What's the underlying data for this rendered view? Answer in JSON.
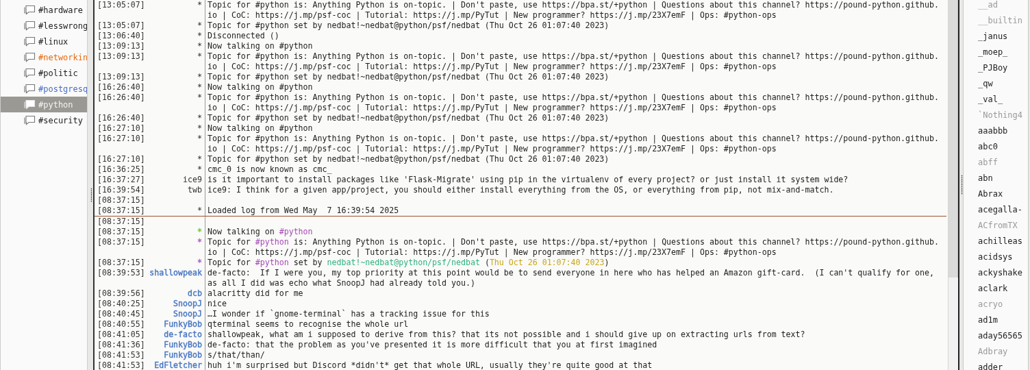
{
  "channels": [
    {
      "name": "#hardware",
      "selected": false
    },
    {
      "name": "#lesswrong",
      "selected": false
    },
    {
      "name": "#linux",
      "selected": false
    },
    {
      "name": "#networkin",
      "selected": false,
      "color": "#e66a0e"
    },
    {
      "name": "#politic",
      "selected": false
    },
    {
      "name": "#postgresq",
      "selected": false,
      "color": "#4a6fc4"
    },
    {
      "name": "#python",
      "selected": true
    },
    {
      "name": "#security",
      "selected": false
    }
  ],
  "log": {
    "history": [
      {
        "time": "[13:05:07]",
        "nick": "*",
        "text": "Topic for #python is: Anything Python is on-topic. | Don't paste, use https://bpa.st/+python | Questions about this channel? https://pound-python.github.io | CoC: https://j.mp/psf-coc | Tutorial: https://j.mp/PyTut | New programmer? https://j.mp/23X7emF | Ops: #python-ops"
      },
      {
        "time": "[13:05:07]",
        "nick": "*",
        "text": "Topic for #python set by nedbat!~nedbat@python/psf/nedbat (Thu Oct 26 01:07:40 2023)"
      },
      {
        "time": "[13:06:40]",
        "nick": "*",
        "text": "Disconnected ()"
      },
      {
        "time": "[13:09:13]",
        "nick": "*",
        "text": "Now talking on #python"
      },
      {
        "time": "[13:09:13]",
        "nick": "*",
        "text": "Topic for #python is: Anything Python is on-topic. | Don't paste, use https://bpa.st/+python | Questions about this channel? https://pound-python.github.io | CoC: https://j.mp/psf-coc | Tutorial: https://j.mp/PyTut | New programmer? https://j.mp/23X7emF | Ops: #python-ops"
      },
      {
        "time": "[13:09:13]",
        "nick": "*",
        "text": "Topic for #python set by nedbat!~nedbat@python/psf/nedbat (Thu Oct 26 01:07:40 2023)"
      },
      {
        "time": "[16:26:40]",
        "nick": "*",
        "text": "Now talking on #python"
      },
      {
        "time": "[16:26:40]",
        "nick": "*",
        "text": "Topic for #python is: Anything Python is on-topic. | Don't paste, use https://bpa.st/+python | Questions about this channel? https://pound-python.github.io | CoC: https://j.mp/psf-coc | Tutorial: https://j.mp/PyTut | New programmer? https://j.mp/23X7emF | Ops: #python-ops"
      },
      {
        "time": "[16:26:40]",
        "nick": "*",
        "text": "Topic for #python set by nedbat!~nedbat@python/psf/nedbat (Thu Oct 26 01:07:40 2023)"
      },
      {
        "time": "[16:27:10]",
        "nick": "*",
        "text": "Now talking on #python"
      },
      {
        "time": "[16:27:10]",
        "nick": "*",
        "text": "Topic for #python is: Anything Python is on-topic. | Don't paste, use https://bpa.st/+python | Questions about this channel? https://pound-python.github.io | CoC: https://j.mp/psf-coc | Tutorial: https://j.mp/PyTut | New programmer? https://j.mp/23X7emF | Ops: #python-ops"
      },
      {
        "time": "[16:27:10]",
        "nick": "*",
        "text": "Topic for #python set by nedbat!~nedbat@python/psf/nedbat (Thu Oct 26 01:07:40 2023)"
      },
      {
        "time": "[16:36:25]",
        "nick": "*",
        "text": "cmc_0 is now known as cmc_"
      },
      {
        "time": "[16:37:27]",
        "nick": "ice9",
        "text": "is it important to install packages like 'Flask-Migrate' using pip in the virtualenv of every project? or just install it system wide?"
      },
      {
        "time": "[16:39:54]",
        "nick": "twb",
        "text": "ice9: I think for a given app/project, you should either install everything from the OS, or everything from pip, not mix-and-match."
      },
      {
        "time": "[08:37:15]"
      },
      {
        "time": "[08:37:15]",
        "nick": "*",
        "text": "Loaded log from Wed May  7 16:39:54 2025"
      }
    ],
    "current": [
      {
        "time": "[08:37:15]"
      },
      {
        "time": "[08:37:15]",
        "nick": "*",
        "color": "#73c934",
        "segments": [
          {
            "text": "Now talking on "
          },
          {
            "text": "#python",
            "color": "#a64ab8"
          }
        ]
      },
      {
        "time": "[08:37:15]",
        "nick": "*",
        "color": "#b45cc4",
        "segments": [
          {
            "text": "Topic for "
          },
          {
            "text": "#python",
            "color": "#a64ab8"
          },
          {
            "text": " is: Anything Python is on-topic. | Don't paste, use https://bpa.st/+python | Questions about this channel? https://pound-python.github.io | CoC: https://j.mp/psf-coc | Tutorial: https://j.mp/PyTut | New programmer? https://j.mp/23X7emF | Ops: #python-ops"
          }
        ]
      },
      {
        "time": "[08:37:15]",
        "nick": "*",
        "color": "#b45cc4",
        "segments": [
          {
            "text": "Topic for "
          },
          {
            "text": "#python",
            "color": "#a64ab8"
          },
          {
            "text": " set by "
          },
          {
            "text": "nedbat!~nedbat@python/psf/nedbat",
            "color": "#2fb37f"
          },
          {
            "text": " ("
          },
          {
            "text": "Thu Oct 26 01:07:40 2023",
            "color": "#c9a814"
          },
          {
            "text": ")"
          }
        ]
      },
      {
        "time": "[08:39:53]",
        "nick": "shallowpeak",
        "color": "#4a78c2",
        "text": "de-facto:  If I were you, my top priority at this point would be to send everyone in here who has helped an Amazon gift-card.  (I can't qualify for one, as all I did was echo what SnoopJ had already told you.)"
      },
      {
        "time": "[08:39:56]",
        "nick": "dcb",
        "color": "#4a78c2",
        "text": "alacritty did for me"
      },
      {
        "time": "[08:40:25]",
        "nick": "SnoopJ",
        "color": "#4a78c2",
        "text": "nice"
      },
      {
        "time": "[08:40:45]",
        "nick": "SnoopJ",
        "color": "#4a78c2",
        "text": "…I wonder if `gnome-terminal` has a tracking issue for this"
      },
      {
        "time": "[08:40:55]",
        "nick": "FunkyBob",
        "color": "#4a78c2",
        "text": "qterminal seems to recognise the whole url"
      },
      {
        "time": "[08:41:05]",
        "nick": "de-facto",
        "color": "#4a78c2",
        "text": "shallowpeak, what am i supposed to derive from this? that its not possible and i should give up on extracting urls from text?"
      },
      {
        "time": "[08:41:36]",
        "nick": "FunkyBob",
        "color": "#4a78c2",
        "text": "de-facto: that the problem as you've presented it is more difficult that you at first imagined"
      },
      {
        "time": "[08:41:53]",
        "nick": "FunkyBob",
        "color": "#4a78c2",
        "text": "s/that/than/"
      },
      {
        "time": "[08:41:53]",
        "nick": "EdFletcher",
        "color": "#4a78c2",
        "text": "huh i'm surprised but Discord *didn't* get that whole URL, usually they're quite good at that"
      }
    ]
  },
  "users": [
    {
      "nick": "__ad",
      "away": true
    },
    {
      "nick": "__builtin",
      "away": true
    },
    {
      "nick": "_janus",
      "away": false
    },
    {
      "nick": "_moep_",
      "away": false
    },
    {
      "nick": "_PJBoy",
      "away": false
    },
    {
      "nick": "_qw",
      "away": false
    },
    {
      "nick": "_val_",
      "away": false
    },
    {
      "nick": "`Nothing4",
      "away": true
    },
    {
      "nick": "aaabbb",
      "away": false
    },
    {
      "nick": "abc0",
      "away": false
    },
    {
      "nick": "abff",
      "away": true
    },
    {
      "nick": "abn",
      "away": false
    },
    {
      "nick": "Abrax",
      "away": false
    },
    {
      "nick": "acegalla-",
      "away": false
    },
    {
      "nick": "ACfromTX",
      "away": true
    },
    {
      "nick": "achilleas",
      "away": false
    },
    {
      "nick": "acidsys",
      "away": false
    },
    {
      "nick": "ackyshake",
      "away": false
    },
    {
      "nick": "aclark",
      "away": false
    },
    {
      "nick": "acryo",
      "away": true
    },
    {
      "nick": "ad1m",
      "away": false
    },
    {
      "nick": "aday56565",
      "away": false
    },
    {
      "nick": "Adbray",
      "away": true
    },
    {
      "nick": "adder",
      "away": false
    }
  ]
}
